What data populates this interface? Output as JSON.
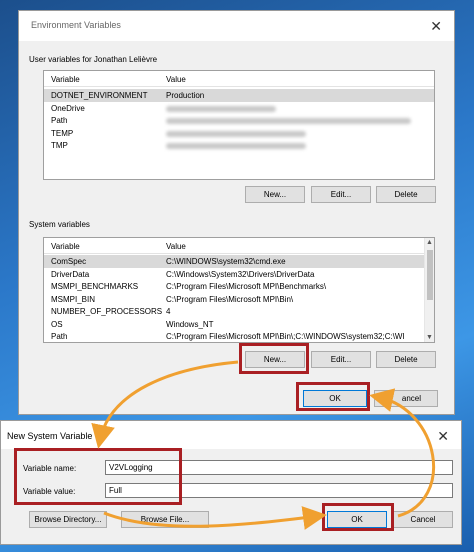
{
  "env_window": {
    "title": "Environment Variables",
    "close_icon": "✕",
    "user_group_label": "User variables for Jonathan Lelièvre",
    "columns": [
      "Variable",
      "Value"
    ],
    "user_vars": [
      {
        "name": "DOTNET_ENVIRONMENT",
        "value": "Production"
      },
      {
        "name": "OneDrive",
        "value": ""
      },
      {
        "name": "Path",
        "value": ""
      },
      {
        "name": "TEMP",
        "value": ""
      },
      {
        "name": "TMP",
        "value": ""
      }
    ],
    "user_buttons": {
      "new": "New...",
      "edit": "Edit...",
      "delete": "Delete"
    },
    "system_group_label": "System variables",
    "system_vars": [
      {
        "name": "ComSpec",
        "value": "C:\\WINDOWS\\system32\\cmd.exe"
      },
      {
        "name": "DriverData",
        "value": "C:\\Windows\\System32\\Drivers\\DriverData"
      },
      {
        "name": "MSMPI_BENCHMARKS",
        "value": "C:\\Program Files\\Microsoft MPI\\Benchmarks\\"
      },
      {
        "name": "MSMPI_BIN",
        "value": "C:\\Program Files\\Microsoft MPI\\Bin\\"
      },
      {
        "name": "NUMBER_OF_PROCESSORS",
        "value": "4"
      },
      {
        "name": "OS",
        "value": "Windows_NT"
      },
      {
        "name": "Path",
        "value": "C:\\Program Files\\Microsoft MPI\\Bin\\;C:\\WINDOWS\\system32;C:\\WI"
      }
    ],
    "system_buttons": {
      "new": "New...",
      "edit": "Edit...",
      "delete": "Delete"
    },
    "ok": "OK",
    "cancel_partial": "ancel"
  },
  "new_var_dialog": {
    "title": "New System Variable",
    "close_icon": "✕",
    "name_label": "Variable name:",
    "name_value": "V2VLogging",
    "value_label": "Variable value:",
    "value_value": "Full",
    "browse_directory": "Browse Directory...",
    "browse_file": "Browse File...",
    "ok": "OK",
    "cancel": "Cancel"
  },
  "colors": {
    "highlight_box": "#a91f23",
    "arrow": "#f0a030",
    "selected_row": "#d9d9d9"
  }
}
